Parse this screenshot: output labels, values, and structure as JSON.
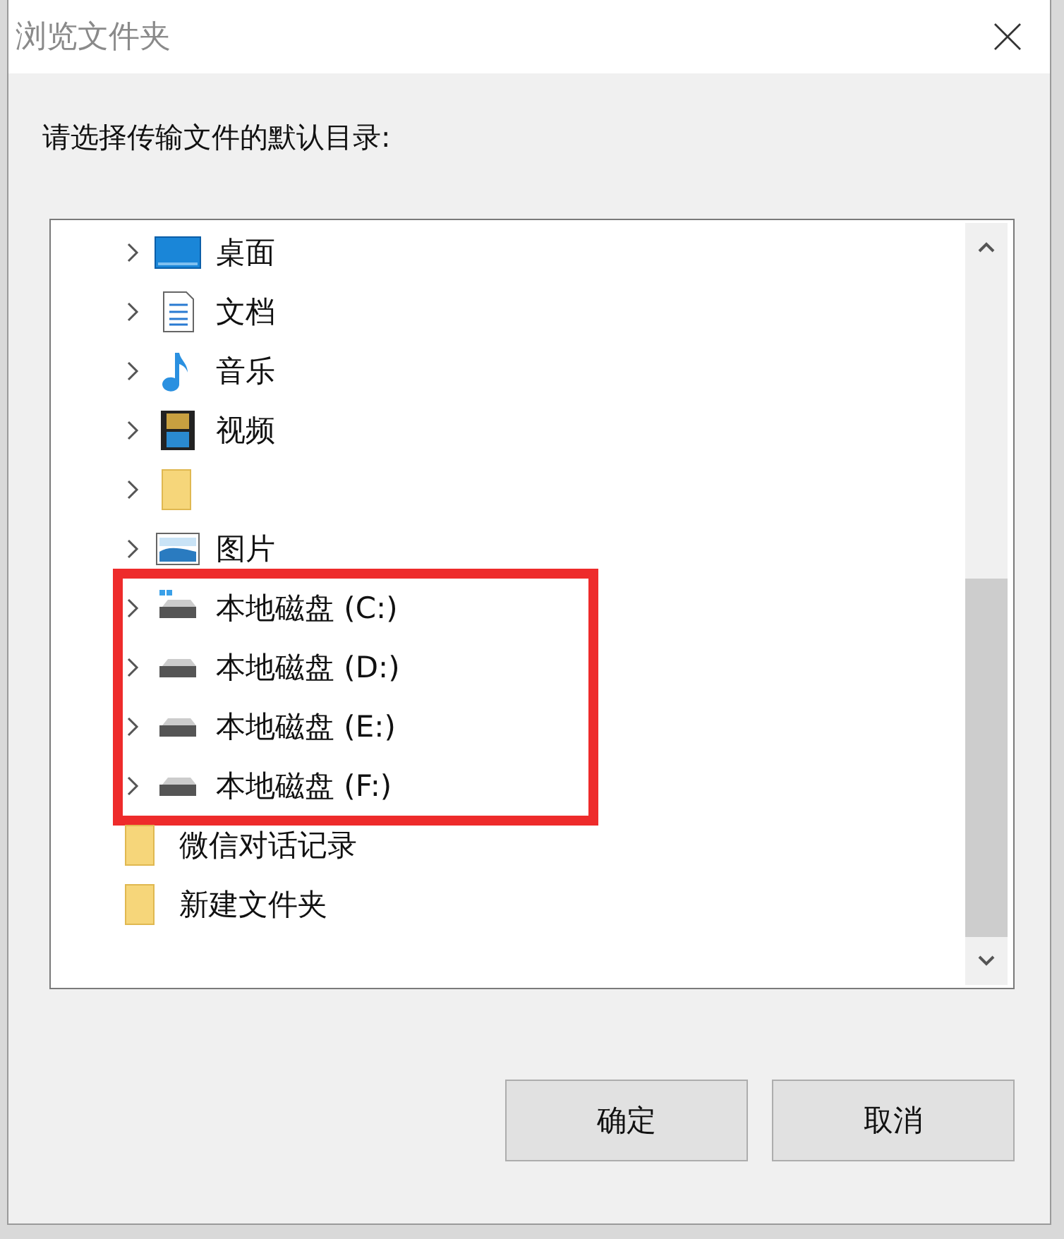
{
  "window": {
    "title": "浏览文件夹"
  },
  "prompt": "请选择传输文件的默认目录:",
  "tree": {
    "items": [
      {
        "label": "桌面",
        "kind": "desktop",
        "expandable": true,
        "highlighted": false
      },
      {
        "label": "文档",
        "kind": "document",
        "expandable": true,
        "highlighted": false
      },
      {
        "label": "音乐",
        "kind": "music",
        "expandable": true,
        "highlighted": false
      },
      {
        "label": "视频",
        "kind": "video",
        "expandable": true,
        "highlighted": false
      },
      {
        "kind": "folder",
        "expandable": true,
        "highlighted": false
      },
      {
        "label": "图片",
        "kind": "picture",
        "expandable": true,
        "highlighted": false
      },
      {
        "label": "本地磁盘 (C:)",
        "kind": "system-drive",
        "expandable": true,
        "highlighted": true
      },
      {
        "label": "本地磁盘 (D:)",
        "kind": "drive",
        "expandable": true,
        "highlighted": true
      },
      {
        "label": "本地磁盘 (E:)",
        "kind": "drive",
        "expandable": true,
        "highlighted": true
      },
      {
        "label": "本地磁盘 (F:)",
        "kind": "drive",
        "expandable": true,
        "highlighted": true
      },
      {
        "label": "微信对话记录",
        "kind": "folder",
        "expandable": false,
        "highlighted": false
      },
      {
        "label": "新建文件夹",
        "kind": "folder",
        "expandable": false,
        "highlighted": false
      }
    ]
  },
  "buttons": [
    {
      "label": "确定"
    },
    {
      "label": "取消"
    }
  ]
}
